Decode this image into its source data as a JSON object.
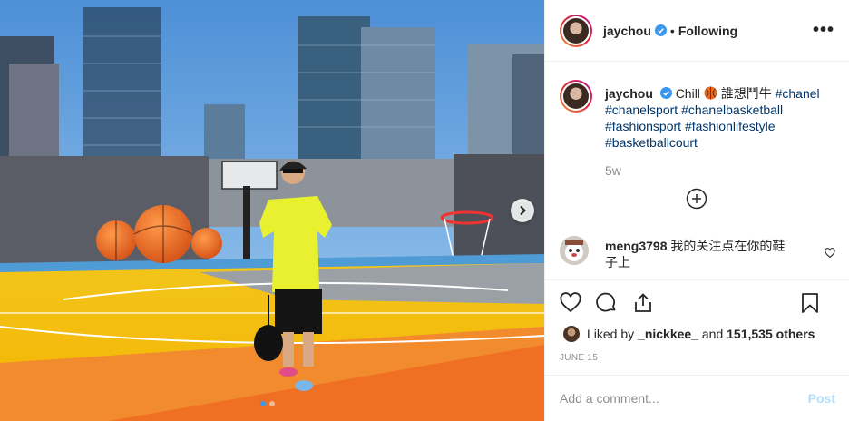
{
  "post": {
    "username": "jaychou",
    "follow_sep": "•",
    "follow_status": "Following",
    "more_icon": "more-icon",
    "caption_user": "jaychou",
    "caption_text": "Chill",
    "caption_emoji": "basketball",
    "caption_text2": "誰想鬥牛",
    "hashtags": [
      "#chanel",
      "#chanelsport",
      "#chanelbasketball",
      "#fashionsport",
      "#fashionlifestyle",
      "#basketballcourt"
    ],
    "time_ago": "5w",
    "comment_user": "meng3798",
    "comment_text": "我的关注点在你的鞋子上",
    "likes_prefix": "Liked by",
    "likes_user": "_nickkee_",
    "likes_and": "and",
    "likes_count": "151,535 others",
    "date": "JUNE 15",
    "add_comment_placeholder": "Add a comment...",
    "post_label": "Post",
    "accent": "#3897f0",
    "hashtag_color": "#003569",
    "carousel_active_index": 1,
    "carousel_count": 2
  }
}
